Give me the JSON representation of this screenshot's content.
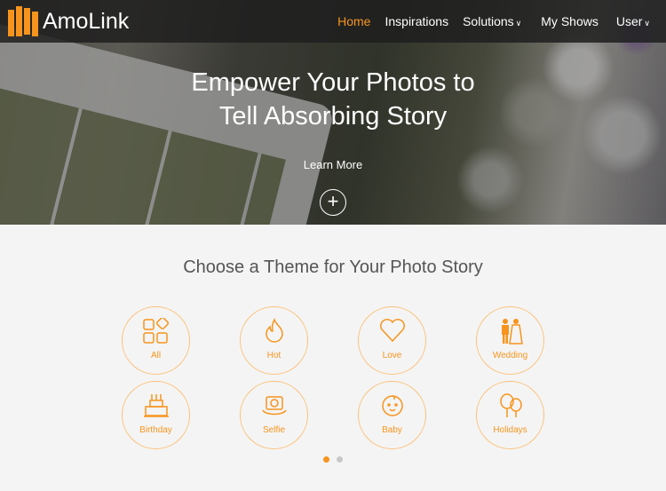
{
  "brand": {
    "name": "AmoLink",
    "accent": "#f7941d"
  },
  "nav": {
    "items": [
      {
        "label": "Home",
        "active": true
      },
      {
        "label": "Inspirations"
      },
      {
        "label": "Solutions",
        "dropdown": true
      },
      {
        "label": "My Shows"
      },
      {
        "label": "User",
        "dropdown": true
      }
    ]
  },
  "hero": {
    "title_line1": "Empower Your Photos to",
    "title_line2": "Tell Absorbing Story",
    "cta": "Learn More",
    "cta_icon": "plus-circle-icon"
  },
  "themes": {
    "title": "Choose a Theme for Your Photo Story",
    "items": [
      {
        "label": "All",
        "icon": "grid-icon"
      },
      {
        "label": "Hot",
        "icon": "flame-icon"
      },
      {
        "label": "Love",
        "icon": "heart-icon"
      },
      {
        "label": "Wedding",
        "icon": "couple-icon"
      },
      {
        "label": "Birthday",
        "icon": "cake-icon"
      },
      {
        "label": "Selfie",
        "icon": "camera-rotate-icon"
      },
      {
        "label": "Baby",
        "icon": "baby-face-icon"
      },
      {
        "label": "Holidays",
        "icon": "balloons-icon"
      }
    ],
    "pagination": {
      "pages": 2,
      "current": 1
    }
  }
}
